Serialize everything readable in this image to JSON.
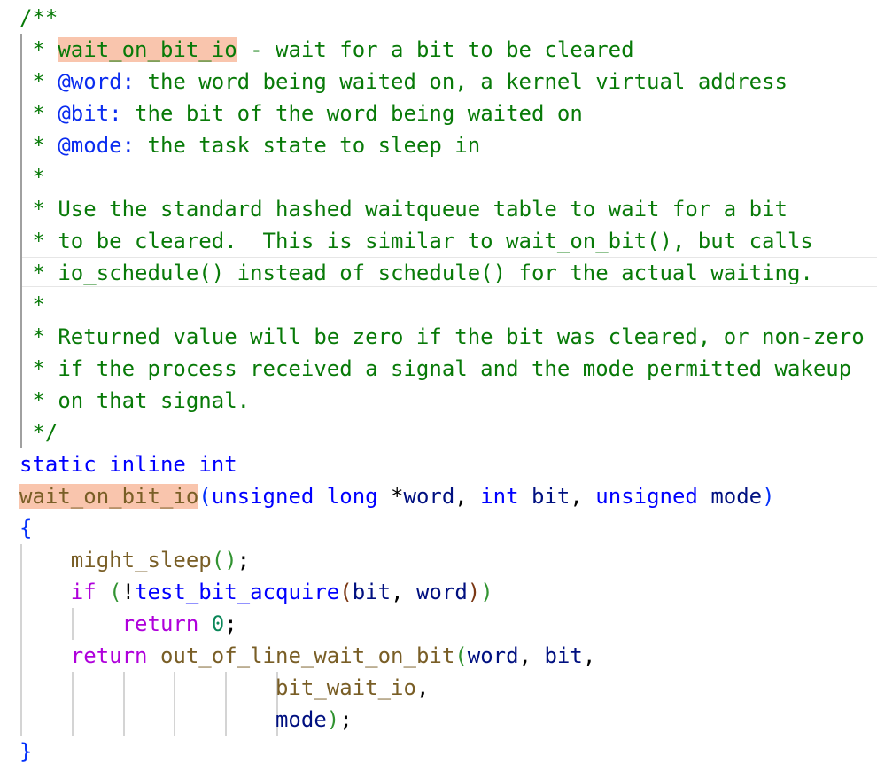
{
  "colors": {
    "comment": "#087a08",
    "keyword": "#0000ff",
    "function": "#795e26",
    "variable": "#001080",
    "control": "#af00db",
    "number": "#098658",
    "highlight": "#f9c5ad"
  },
  "current_line": 8,
  "lines": [
    [
      [
        "/**",
        "c"
      ]
    ],
    [
      [
        " * ",
        "c"
      ],
      [
        "wait_on_bit_io",
        "c h"
      ],
      [
        " - wait for a bit to be cleared",
        "c"
      ]
    ],
    [
      [
        " * ",
        "c"
      ],
      [
        "@word:",
        "t"
      ],
      [
        " the word being waited on, a kernel virtual address",
        "c"
      ]
    ],
    [
      [
        " * ",
        "c"
      ],
      [
        "@bit:",
        "t"
      ],
      [
        " the bit of the word being waited on",
        "c"
      ]
    ],
    [
      [
        " * ",
        "c"
      ],
      [
        "@mode:",
        "t"
      ],
      [
        " the task state to sleep in",
        "c"
      ]
    ],
    [
      [
        " *",
        "c"
      ]
    ],
    [
      [
        " * Use the standard hashed waitqueue table to wait for a bit",
        "c"
      ]
    ],
    [
      [
        " * to be cleared.  This is similar to wait_on_bit(), but calls",
        "c"
      ]
    ],
    [
      [
        " * io_schedule() instead of schedule() for the actual waiting.",
        "c"
      ]
    ],
    [
      [
        " *",
        "c"
      ]
    ],
    [
      [
        " * Returned value will be zero if the bit was cleared, or non-zero",
        "c"
      ]
    ],
    [
      [
        " * if the process received a signal and the mode permitted wakeup",
        "c"
      ]
    ],
    [
      [
        " * on that signal.",
        "c"
      ]
    ],
    [
      [
        " */",
        "c"
      ]
    ],
    [
      [
        "static",
        "k"
      ],
      [
        " ",
        "d"
      ],
      [
        "inline",
        "k"
      ],
      [
        " ",
        "d"
      ],
      [
        "int",
        "k"
      ]
    ],
    [
      [
        "wait_on_bit_io",
        "f h"
      ],
      [
        "(",
        "b1"
      ],
      [
        "unsigned",
        "k"
      ],
      [
        " ",
        "d"
      ],
      [
        "long",
        "k"
      ],
      [
        " *",
        "d"
      ],
      [
        "word",
        "v"
      ],
      [
        ", ",
        "d"
      ],
      [
        "int",
        "k"
      ],
      [
        " ",
        "d"
      ],
      [
        "bit",
        "v"
      ],
      [
        ", ",
        "d"
      ],
      [
        "unsigned",
        "k"
      ],
      [
        " ",
        "d"
      ],
      [
        "mode",
        "v"
      ],
      [
        ")",
        "b1"
      ]
    ],
    [
      [
        "{",
        "b1"
      ]
    ],
    [
      [
        "    ",
        "d"
      ],
      [
        "might_sleep",
        "f"
      ],
      [
        "()",
        "b2"
      ],
      [
        ";",
        "d"
      ]
    ],
    [
      [
        "    ",
        "d"
      ],
      [
        "if",
        "p"
      ],
      [
        " ",
        "d"
      ],
      [
        "(",
        "b2"
      ],
      [
        "!",
        "d"
      ],
      [
        "test_bit_acquire",
        "k"
      ],
      [
        "(",
        "b3"
      ],
      [
        "bit",
        "v"
      ],
      [
        ", ",
        "d"
      ],
      [
        "word",
        "v"
      ],
      [
        ")",
        "b3"
      ],
      [
        ")",
        "b2"
      ]
    ],
    [
      [
        "        ",
        "d"
      ],
      [
        "return",
        "p"
      ],
      [
        " ",
        "d"
      ],
      [
        "0",
        "n"
      ],
      [
        ";",
        "d"
      ]
    ],
    [
      [
        "    ",
        "d"
      ],
      [
        "return",
        "p"
      ],
      [
        " ",
        "d"
      ],
      [
        "out_of_line_wait_on_bit",
        "f"
      ],
      [
        "(",
        "b2"
      ],
      [
        "word",
        "v"
      ],
      [
        ", ",
        "d"
      ],
      [
        "bit",
        "v"
      ],
      [
        ",",
        "d"
      ]
    ],
    [
      [
        "                    ",
        "d"
      ],
      [
        "bit_wait_io",
        "f"
      ],
      [
        ",",
        "d"
      ]
    ],
    [
      [
        "                    ",
        "d"
      ],
      [
        "mode",
        "v"
      ],
      [
        ")",
        "b2"
      ],
      [
        ";",
        "d"
      ]
    ],
    [
      [
        "}",
        "b1"
      ]
    ]
  ]
}
